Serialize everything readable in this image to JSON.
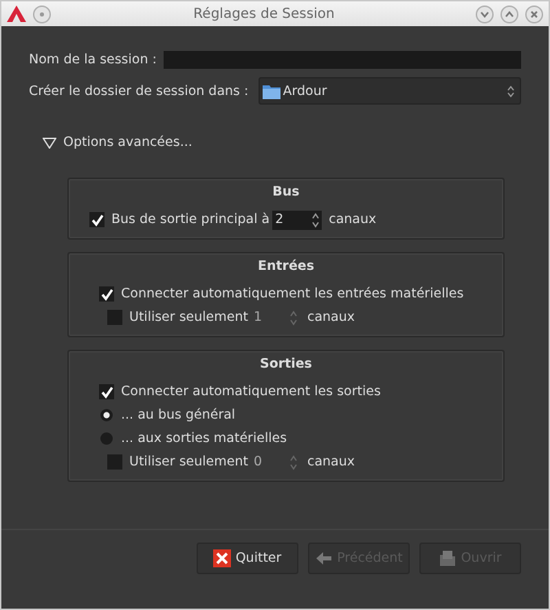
{
  "window": {
    "title": "Réglages de Session"
  },
  "session_name": {
    "label": "Nom de la session :"
  },
  "folder": {
    "label": "Créer le dossier de session dans :",
    "value": "Ardour"
  },
  "advanced": {
    "label": "Options avancées...",
    "expanded": true
  },
  "sections": [
    {
      "title": "Bus",
      "rows": [
        {
          "kind": "check_spin",
          "checked": true,
          "disabled": false,
          "label": "Bus de sortie principal à",
          "value": "2",
          "unit": "canaux"
        }
      ]
    },
    {
      "title": "Entrées",
      "rows": [
        {
          "kind": "check",
          "checked": true,
          "label": "Connecter automatiquement les entrées matérielles"
        },
        {
          "kind": "check_spin",
          "checked": false,
          "disabled": true,
          "label": "Utiliser seulement",
          "value": "1",
          "unit": "canaux"
        }
      ]
    },
    {
      "title": "Sorties",
      "rows": [
        {
          "kind": "check",
          "checked": true,
          "label": "Connecter automatiquement les sorties"
        },
        {
          "kind": "radio",
          "selected": true,
          "label": "... au bus général"
        },
        {
          "kind": "radio",
          "selected": false,
          "label": "... aux sorties matérielles"
        },
        {
          "kind": "check_spin",
          "checked": false,
          "disabled": true,
          "label": "Utiliser seulement",
          "value": "0",
          "unit": "canaux"
        }
      ]
    }
  ],
  "buttons": [
    {
      "label": "Quitter",
      "kind": "quit",
      "disabled": false
    },
    {
      "label": "Précédent",
      "kind": "back",
      "disabled": true
    },
    {
      "label": "Ouvrir",
      "kind": "open",
      "disabled": true
    }
  ]
}
